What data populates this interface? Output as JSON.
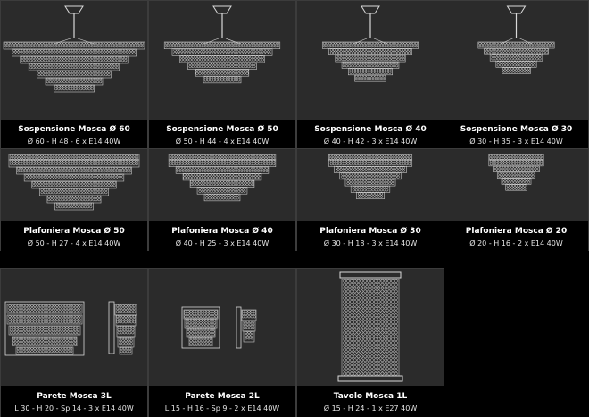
{
  "colors": {
    "tile_bg": "#2b2b2b",
    "caption_bg": "#000000",
    "crystal": "#d9d9d9",
    "text": "#ffffff"
  },
  "products": [
    {
      "id": "sosp60",
      "name": "Sospensione Mosca Ø 60",
      "spec": "Ø 60 - H 48 - 6 x E14 40W",
      "icon": "suspension-chandelier-icon"
    },
    {
      "id": "sosp50",
      "name": "Sospensione Mosca Ø 50",
      "spec": "Ø 50 - H 44 - 4 x E14 40W",
      "icon": "suspension-chandelier-icon"
    },
    {
      "id": "sosp40",
      "name": "Sospensione Mosca Ø 40",
      "spec": "Ø 40 - H 42 - 3 x E14 40W",
      "icon": "suspension-chandelier-icon"
    },
    {
      "id": "sosp30",
      "name": "Sospensione Mosca Ø 30",
      "spec": "Ø 30 - H 35 - 3 x E14 40W",
      "icon": "suspension-chandelier-icon"
    },
    {
      "id": "plaf50",
      "name": "Plafoniera Mosca Ø 50",
      "spec": "Ø 50 - H 27 - 4 x E14 40W",
      "icon": "ceiling-lamp-icon"
    },
    {
      "id": "plaf40",
      "name": "Plafoniera Mosca Ø 40",
      "spec": "Ø 40 - H 25 - 3 x E14 40W",
      "icon": "ceiling-lamp-icon"
    },
    {
      "id": "plaf30",
      "name": "Plafoniera Mosca Ø 30",
      "spec": "Ø 30 - H 18 - 3 x E14 40W",
      "icon": "ceiling-lamp-icon"
    },
    {
      "id": "plaf20",
      "name": "Plafoniera Mosca Ø 20",
      "spec": "Ø 20 - H 16 - 2 x E14 40W",
      "icon": "ceiling-lamp-icon"
    },
    {
      "id": "par3l",
      "name": "Parete Mosca 3L",
      "spec": "L 30 - H 20 - Sp 14 - 3 x E14 40W",
      "icon": "wall-lamp-icon"
    },
    {
      "id": "par2l",
      "name": "Parete Mosca 2L",
      "spec": "L 15 - H 16 - Sp 9 - 2 x E14 40W",
      "icon": "wall-lamp-icon"
    },
    {
      "id": "tav1l",
      "name": "Tavolo Mosca 1L",
      "spec": "Ø 15 - H 24 - 1 x E27 40W",
      "icon": "table-lamp-icon"
    }
  ]
}
